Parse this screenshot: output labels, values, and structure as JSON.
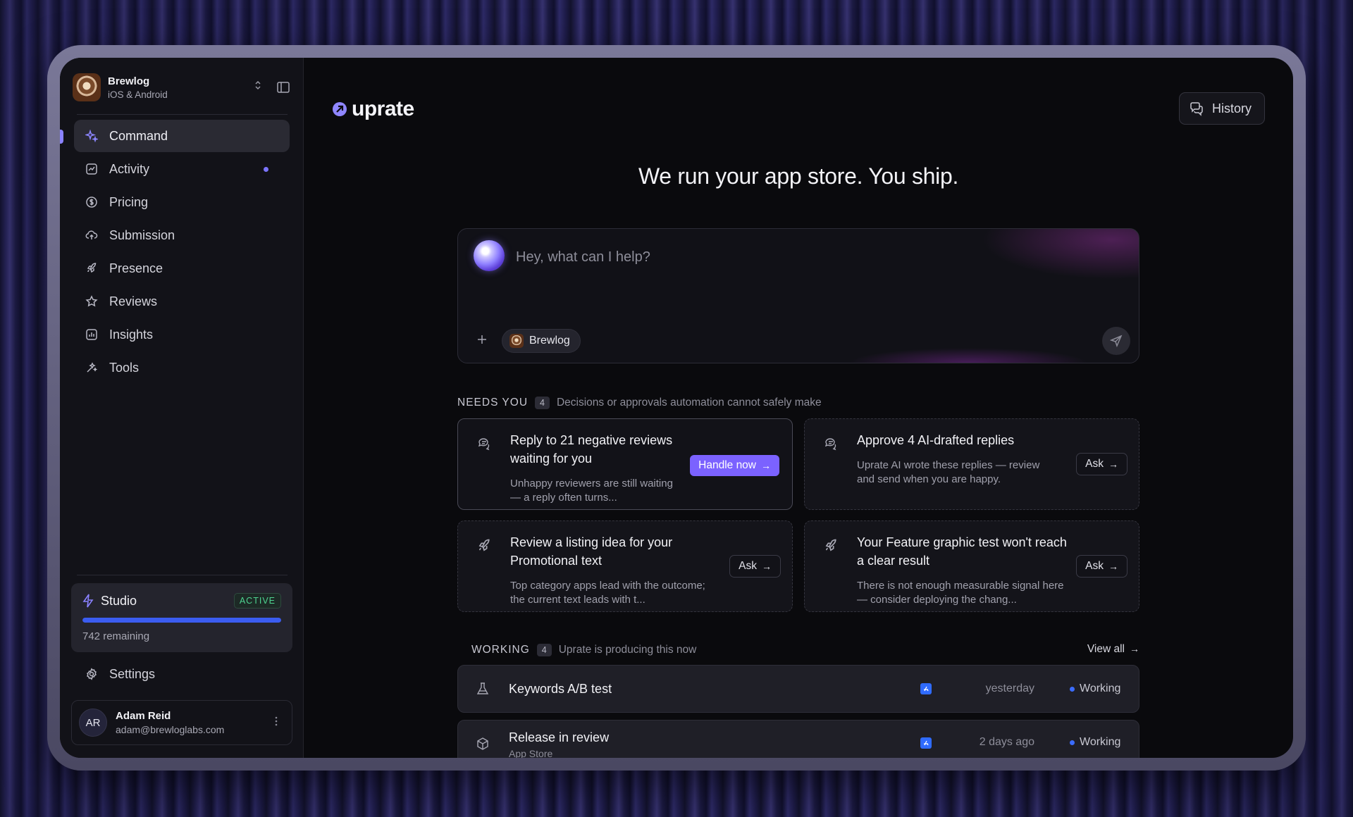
{
  "app": {
    "name": "Brewlog",
    "platforms": "iOS & Android"
  },
  "nav": [
    {
      "label": "Command",
      "icon": "sparkle-icon",
      "active": true
    },
    {
      "label": "Activity",
      "icon": "activity-icon",
      "has_dot": true
    },
    {
      "label": "Pricing",
      "icon": "dollar-icon"
    },
    {
      "label": "Submission",
      "icon": "cloud-upload-icon"
    },
    {
      "label": "Presence",
      "icon": "rocket-icon"
    },
    {
      "label": "Reviews",
      "icon": "star-icon"
    },
    {
      "label": "Insights",
      "icon": "bar-chart-icon"
    },
    {
      "label": "Tools",
      "icon": "tools-icon"
    }
  ],
  "studio": {
    "title": "Studio",
    "badge": "ACTIVE",
    "remaining": "742 remaining",
    "progress": 1.0
  },
  "settings_label": "Settings",
  "user": {
    "initials": "AR",
    "name": "Adam Reid",
    "email": "adam@brewloglabs.com"
  },
  "header": {
    "logo_text": "uprate",
    "history_label": "History"
  },
  "hero": "We run your app store. You ship.",
  "composer": {
    "placeholder": "Hey, what can I help?",
    "chip_label": "Brewlog"
  },
  "needs_you": {
    "title": "NEEDS YOU",
    "count": "4",
    "description": "Decisions or approvals automation cannot safely make",
    "cards": [
      {
        "title": "Reply to 21 negative reviews waiting for you",
        "description": "Unhappy reviewers are still waiting — a reply often turns...",
        "action": "Handle now",
        "icon": "chat-icon"
      },
      {
        "title": "Approve 4 AI-drafted replies",
        "description": "Uprate AI wrote these replies — review and send when you are happy.",
        "action": "Ask",
        "icon": "chat-icon"
      },
      {
        "title": "Review a listing idea for your Promotional text",
        "description": "Top category apps lead with the outcome; the current text leads with t...",
        "action": "Ask",
        "icon": "rocket-icon"
      },
      {
        "title": "Your Feature graphic test won't reach a clear result",
        "description": "There is not enough measurable signal here — consider deploying the chang...",
        "action": "Ask",
        "icon": "rocket-icon"
      }
    ]
  },
  "working": {
    "title": "WORKING",
    "count": "4",
    "description": "Uprate is producing this now",
    "view_all": "View all",
    "rows": [
      {
        "title": "Keywords A/B test",
        "subtitle": "",
        "when": "yesterday",
        "status": "Working",
        "icon": "flask-icon"
      },
      {
        "title": "Release in review",
        "subtitle": "App Store",
        "when": "2 days ago",
        "status": "Working",
        "icon": "package-icon"
      }
    ]
  },
  "colors": {
    "accent": "#7b62ff",
    "active_badge": "#4ed490",
    "progress": "#3b5cf0",
    "status_dot": "#3b6cff"
  }
}
